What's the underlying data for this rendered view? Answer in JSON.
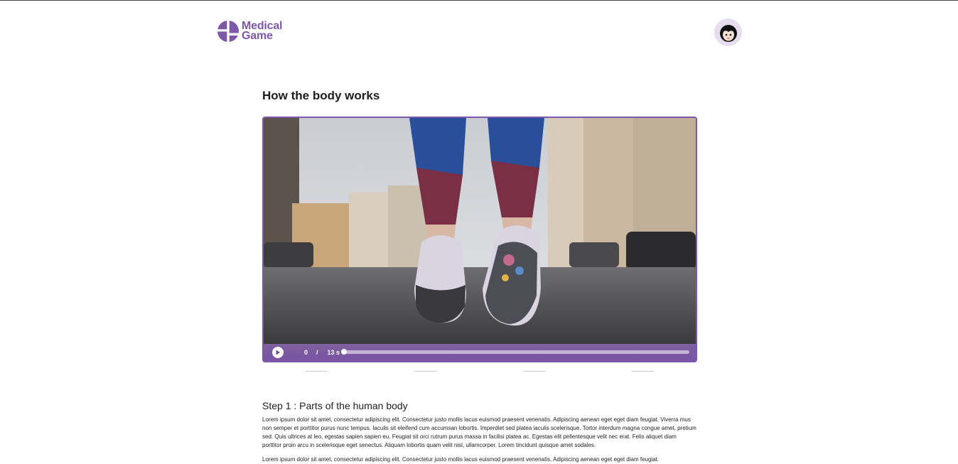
{
  "header": {
    "logo_line1": "Medical",
    "logo_line2": "Game",
    "logo_icon": "medical-game-logo-icon",
    "avatar_icon": "user-avatar-icon"
  },
  "main": {
    "title": "How the body works",
    "video": {
      "current_time": "0",
      "separator": "/",
      "duration": "13 s",
      "progress": 0.0,
      "play_icon": "play-icon"
    },
    "step": {
      "title": "Step 1 : Parts of the human body",
      "paragraph1": "Lorem ipsum dolor sit amet, consectetur adipiscing elit. Consectetur justo mollis lacus euismod praesent venenatis. Adipiscing aenean eget eget diam feugiat. Viverra mus non semper et porttitor purus nunc tempus. Iaculis sit eleifend cum accumsan lobortis. Imperdiet sed platea iaculis scelerisque. Tortor interdum magna congue amet, pretium sed. Quis ultrices at leo, egestas sapien sapien eu. Feugiat sit orci rutrum purus massa in facilisi platea ac. Egestas elit pellentesque velit nec erat. Felis aliquet diam porttitor proin arcu in scelerisque eget senectus. Aliquam lobortis quam velit nisl, ullamcorper. Lorem tincidunt quisque amet sodales.",
      "paragraph2": "Lorem ipsum dolor sit amet, consectetur adipiscing elit. Consectetur justo mollis lacus euismod praesent venenatis. Adipiscing aenean eget eget diam feugiat."
    }
  },
  "colors": {
    "brand": "#7d58a8",
    "avatar_bg": "#e7ddf1"
  }
}
